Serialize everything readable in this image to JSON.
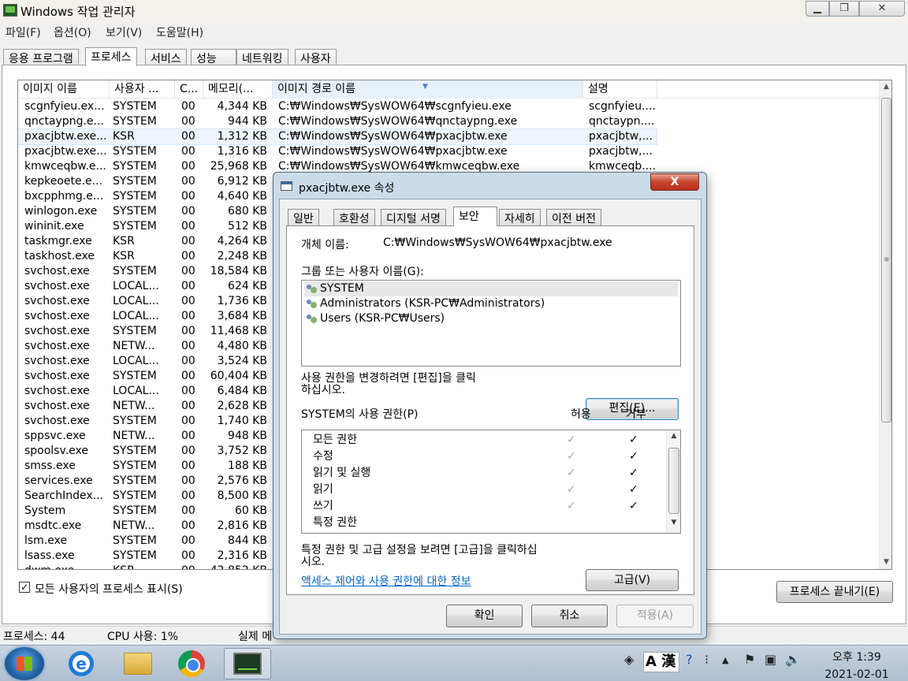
{
  "window": {
    "title": "Windows 작업 관리자"
  },
  "menubar": [
    "파일(F)",
    "옵션(O)",
    "보기(V)",
    "도움말(H)"
  ],
  "tabs": [
    "응용 프로그램",
    "프로세스",
    "서비스",
    "성능",
    "네트워킹",
    "사용자"
  ],
  "active_tab": "프로세스",
  "columns": [
    "이미지 이름",
    "사용자 ...",
    "C...",
    "메모리(...",
    "이미지 경로 이름",
    "설명"
  ],
  "processes": [
    [
      "scgnfyieu.ex...",
      "SYSTEM",
      "00",
      "4,344 KB",
      "C:₩Windows₩SysWOW64₩scgnfyieu.exe",
      "scgnfyieu...."
    ],
    [
      "qnctaypng.e...",
      "SYSTEM",
      "00",
      "944 KB",
      "C:₩Windows₩SysWOW64₩qnctaypng.exe",
      "qnctaypn...."
    ],
    [
      "pxacjbtw.exe...",
      "KSR",
      "00",
      "1,312 KB",
      "C:₩Windows₩SysWOW64₩pxacjbtw.exe",
      "pxacjbtw,..."
    ],
    [
      "pxacjbtw.exe...",
      "SYSTEM",
      "00",
      "1,316 KB",
      "C:₩Windows₩SysWOW64₩pxacjbtw.exe",
      "pxacjbtw,..."
    ],
    [
      "kmwceqbw.e...",
      "SYSTEM",
      "00",
      "25,968 KB",
      "C:₩Windows₩SysWOW64₩kmwceqbw.exe",
      "kmwceqb...."
    ],
    [
      "kepkeoete.e...",
      "SYSTEM",
      "00",
      "6,912 KB",
      "",
      ""
    ],
    [
      "bxcpphmg.e...",
      "SYSTEM",
      "00",
      "4,640 KB",
      "",
      ""
    ],
    [
      "winlogon.exe",
      "SYSTEM",
      "00",
      "680 KB",
      "",
      ""
    ],
    [
      "wininit.exe",
      "SYSTEM",
      "00",
      "512 KB",
      "",
      ""
    ],
    [
      "taskmgr.exe",
      "KSR",
      "00",
      "4,264 KB",
      "",
      ""
    ],
    [
      "taskhost.exe",
      "KSR",
      "00",
      "2,248 KB",
      "",
      ""
    ],
    [
      "svchost.exe",
      "SYSTEM",
      "00",
      "18,584 KB",
      "",
      ""
    ],
    [
      "svchost.exe",
      "LOCAL...",
      "00",
      "624 KB",
      "",
      ""
    ],
    [
      "svchost.exe",
      "LOCAL...",
      "00",
      "1,736 KB",
      "",
      ""
    ],
    [
      "svchost.exe",
      "LOCAL...",
      "00",
      "3,684 KB",
      "",
      ""
    ],
    [
      "svchost.exe",
      "SYSTEM",
      "00",
      "11,468 KB",
      "",
      ""
    ],
    [
      "svchost.exe",
      "NETW...",
      "00",
      "4,480 KB",
      "",
      ""
    ],
    [
      "svchost.exe",
      "LOCAL...",
      "00",
      "3,524 KB",
      "",
      ""
    ],
    [
      "svchost.exe",
      "SYSTEM",
      "00",
      "60,404 KB",
      "",
      ""
    ],
    [
      "svchost.exe",
      "LOCAL...",
      "00",
      "6,484 KB",
      "",
      ""
    ],
    [
      "svchost.exe",
      "NETW...",
      "00",
      "2,628 KB",
      "",
      ""
    ],
    [
      "svchost.exe",
      "SYSTEM",
      "00",
      "1,740 KB",
      "",
      ""
    ],
    [
      "sppsvc.exe",
      "NETW...",
      "00",
      "948 KB",
      "",
      ""
    ],
    [
      "spoolsv.exe",
      "SYSTEM",
      "00",
      "3,752 KB",
      "",
      ""
    ],
    [
      "smss.exe",
      "SYSTEM",
      "00",
      "188 KB",
      "",
      ""
    ],
    [
      "services.exe",
      "SYSTEM",
      "00",
      "2,576 KB",
      "",
      ""
    ],
    [
      "SearchIndex...",
      "SYSTEM",
      "00",
      "8,500 KB",
      "",
      ""
    ],
    [
      "System",
      "SYSTEM",
      "00",
      "60 KB",
      "",
      ""
    ],
    [
      "msdtc.exe",
      "NETW...",
      "00",
      "2,816 KB",
      "",
      ""
    ],
    [
      "lsm.exe",
      "SYSTEM",
      "00",
      "844 KB",
      "",
      ""
    ],
    [
      "lsass.exe",
      "SYSTEM",
      "00",
      "2,316 KB",
      "",
      ""
    ],
    [
      "dwm.exe",
      "KSR",
      "00",
      "42,852 KB",
      "",
      ""
    ]
  ],
  "show_all_label": "모든 사용자의 프로세스 표시(S)",
  "end_process_label": "프로세스 끝내기(E)",
  "status": {
    "processes": "프로세스: 44",
    "cpu": "CPU 사용: 1%",
    "memory": "실제 메"
  },
  "dialog": {
    "title": "pxacjbtw.exe 속성",
    "close": "X",
    "tabs": [
      "일반",
      "호환성",
      "디지털 서명",
      "보안",
      "자세히",
      "이전 버전"
    ],
    "active_tab": "보안",
    "object_label": "개체 이름:",
    "object_value": "C:₩Windows₩SysWOW64₩pxacjbtw.exe",
    "group_label": "그룹 또는 사용자 이름(G):",
    "groups": [
      "SYSTEM",
      "Administrators (KSR-PC₩Administrators)",
      "Users (KSR-PC₩Users)"
    ],
    "edit_hint_line1": "사용 권한을 변경하려면 [편집]을 클릭",
    "edit_hint_line2": "하십시오.",
    "edit_button": "편집(E)...",
    "perm_label": "SYSTEM의 사용 권한(P)",
    "allow_header": "허용",
    "deny_header": "거부",
    "permissions": [
      {
        "name": "모든 권한",
        "allow": "✓",
        "deny": "✓"
      },
      {
        "name": "수정",
        "allow": "✓",
        "deny": "✓"
      },
      {
        "name": "읽기 및 실행",
        "allow": "✓",
        "deny": "✓"
      },
      {
        "name": "읽기",
        "allow": "✓",
        "deny": "✓"
      },
      {
        "name": "쓰기",
        "allow": "✓",
        "deny": "✓"
      },
      {
        "name": "특정 권한",
        "allow": "",
        "deny": ""
      }
    ],
    "adv_hint_line1": "특정 권한 및 고급 설정을 보려면 [고급]을 클릭하십",
    "adv_hint_line2": "시오.",
    "adv_button": "고급(V)",
    "link": "액세스 제어와 사용 권한에 대한 정보",
    "ok": "확인",
    "cancel": "취소",
    "apply": "적용(A)"
  },
  "taskbar": {
    "apps": [
      "start-button",
      "internet-explorer",
      "windows-explorer",
      "chrome",
      "task-manager"
    ],
    "ime": "A 漢",
    "clock_time": "오후 1:39",
    "clock_date": "2021-02-01"
  }
}
